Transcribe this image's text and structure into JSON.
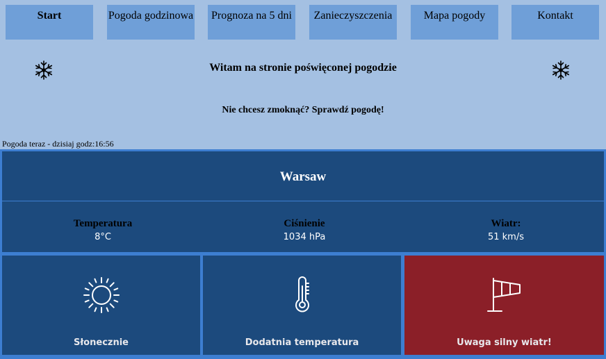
{
  "nav": {
    "items": [
      {
        "label": "Start"
      },
      {
        "label": "Pogoda godzinowa"
      },
      {
        "label": "Prognoza na 5 dni"
      },
      {
        "label": "Zanieczyszczenia"
      },
      {
        "label": "Mapa pogody"
      },
      {
        "label": "Kontakt"
      }
    ]
  },
  "header": {
    "welcome": "Witam na stronie poświęconej pogodzie",
    "tagline": "Nie chcesz zmoknąć? Sprawdź pogodę!",
    "now": "Pogoda teraz - dzisiaj godz:16:56"
  },
  "weather": {
    "city": "Warsaw",
    "temperature_label": "Temperatura",
    "temperature_value": "8°C",
    "pressure_label": "Ciśnienie",
    "pressure_value": "1034 hPa",
    "wind_label": "Wiatr:",
    "wind_value": "51 km/s"
  },
  "cards": [
    {
      "label": "Słonecznie",
      "icon": "sun-icon"
    },
    {
      "label": "Dodatnia temperatura",
      "icon": "thermometer-icon"
    },
    {
      "label": "Uwaga silny wiatr!",
      "icon": "windsock-icon"
    }
  ],
  "colors": {
    "page_bg": "#a4c0e2",
    "nav_bg": "#6f9fd8",
    "panel_bg": "#1c4a7d",
    "border": "#3d7ed1",
    "warning_bg": "#8b1f28"
  }
}
